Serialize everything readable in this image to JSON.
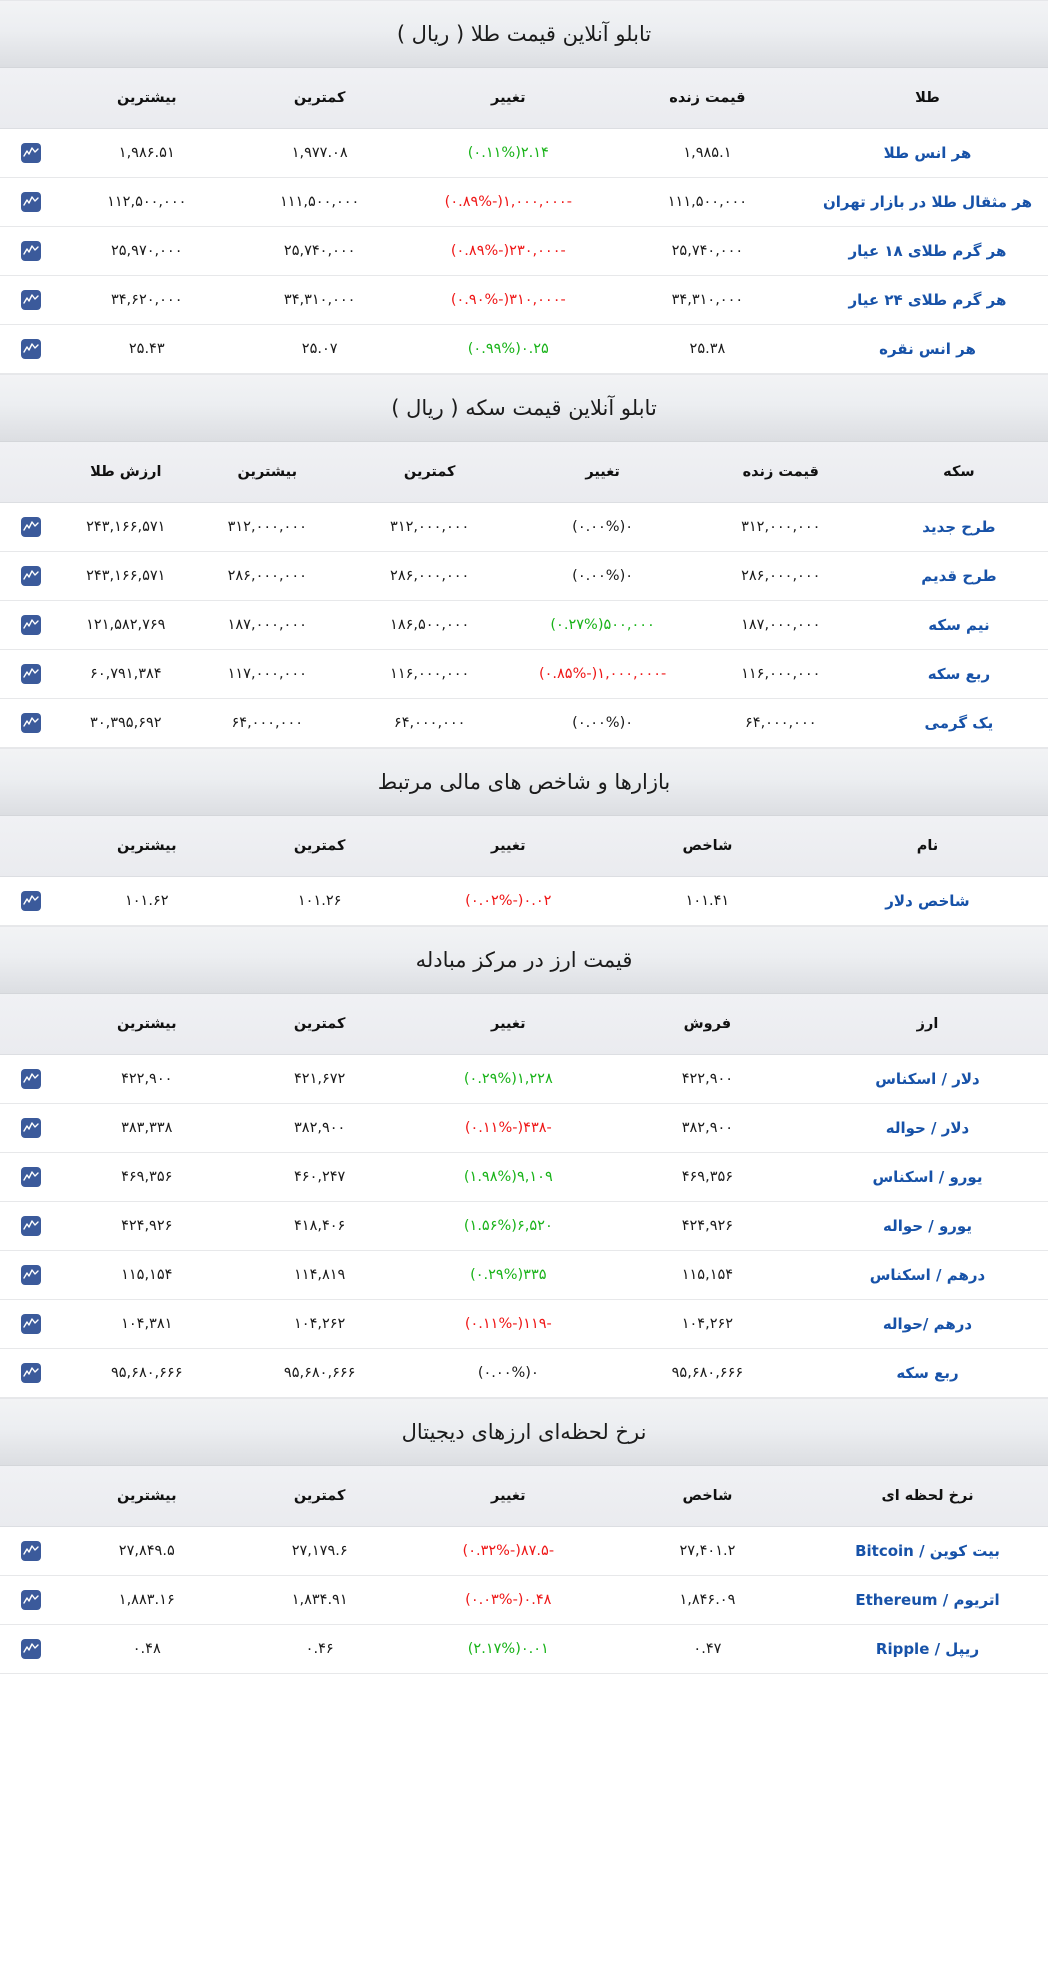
{
  "icons": {
    "chart": "chart-line-icon"
  },
  "colors": {
    "up": "#19b319",
    "down": "#ef1717",
    "flat": "#1a1a1a",
    "link": "#1752a8",
    "icon_bg": "#3b5a9b"
  },
  "sections": [
    {
      "id": "gold",
      "title": "تابلو آنلاین قیمت طلا ( ریال )",
      "columns": [
        "طلا",
        "قیمت زنده",
        "تغییر",
        "کمترین",
        "بیشترین"
      ],
      "rows": [
        {
          "name": "هر انس طلا",
          "live": "۱,۹۸۵.۱",
          "change": "۲.۱۴(۰.۱۱%)",
          "dir": "up",
          "low": "۱,۹۷۷.۰۸",
          "high": "۱,۹۸۶.۵۱"
        },
        {
          "name": "هر مثقال طلا در بازار تهران",
          "live": "۱۱۱,۵۰۰,۰۰۰",
          "change": "-۱,۰۰۰,۰۰۰(-۰.۸۹%)",
          "dir": "down",
          "low": "۱۱۱,۵۰۰,۰۰۰",
          "high": "۱۱۲,۵۰۰,۰۰۰"
        },
        {
          "name": "هر گرم طلای ۱۸ عیار",
          "live": "۲۵,۷۴۰,۰۰۰",
          "change": "-۲۳۰,۰۰۰(-۰.۸۹%)",
          "dir": "down",
          "low": "۲۵,۷۴۰,۰۰۰",
          "high": "۲۵,۹۷۰,۰۰۰"
        },
        {
          "name": "هر گرم طلای ۲۴ عیار",
          "live": "۳۴,۳۱۰,۰۰۰",
          "change": "-۳۱۰,۰۰۰(-۰.۹۰%)",
          "dir": "down",
          "low": "۳۴,۳۱۰,۰۰۰",
          "high": "۳۴,۶۲۰,۰۰۰"
        },
        {
          "name": "هر انس نقره",
          "live": "۲۵.۳۸",
          "change": "۰.۲۵(۰.۹۹%)",
          "dir": "up",
          "low": "۲۵.۰۷",
          "high": "۲۵.۴۳"
        }
      ]
    },
    {
      "id": "coin",
      "title": "تابلو آنلاین قیمت سکه ( ریال )",
      "columns": [
        "سکه",
        "قیمت زنده",
        "تغییر",
        "کمترین",
        "بیشترین",
        "ارزش طلا"
      ],
      "rows": [
        {
          "name": "طرح جدید",
          "live": "۳۱۲,۰۰۰,۰۰۰",
          "change": "۰(۰.۰۰%)",
          "dir": "flat",
          "low": "۳۱۲,۰۰۰,۰۰۰",
          "high": "۳۱۲,۰۰۰,۰۰۰",
          "gold": "۲۴۳,۱۶۶,۵۷۱"
        },
        {
          "name": "طرح قدیم",
          "live": "۲۸۶,۰۰۰,۰۰۰",
          "change": "۰(۰.۰۰%)",
          "dir": "flat",
          "low": "۲۸۶,۰۰۰,۰۰۰",
          "high": "۲۸۶,۰۰۰,۰۰۰",
          "gold": "۲۴۳,۱۶۶,۵۷۱"
        },
        {
          "name": "نیم سکه",
          "live": "۱۸۷,۰۰۰,۰۰۰",
          "change": "۵۰۰,۰۰۰(۰.۲۷%)",
          "dir": "up",
          "low": "۱۸۶,۵۰۰,۰۰۰",
          "high": "۱۸۷,۰۰۰,۰۰۰",
          "gold": "۱۲۱,۵۸۲,۷۶۹"
        },
        {
          "name": "ربع سکه",
          "live": "۱۱۶,۰۰۰,۰۰۰",
          "change": "-۱,۰۰۰,۰۰۰(-۰.۸۵%)",
          "dir": "down",
          "low": "۱۱۶,۰۰۰,۰۰۰",
          "high": "۱۱۷,۰۰۰,۰۰۰",
          "gold": "۶۰,۷۹۱,۳۸۴"
        },
        {
          "name": "یک گرمی",
          "live": "۶۴,۰۰۰,۰۰۰",
          "change": "۰(۰.۰۰%)",
          "dir": "flat",
          "low": "۶۴,۰۰۰,۰۰۰",
          "high": "۶۴,۰۰۰,۰۰۰",
          "gold": "۳۰,۳۹۵,۶۹۲"
        }
      ]
    },
    {
      "id": "markets",
      "title": "بازارها و شاخص های مالی مرتبط",
      "columns": [
        "نام",
        "شاخص",
        "تغییر",
        "کمترین",
        "بیشترین"
      ],
      "rows": [
        {
          "name": "شاخص دلار",
          "live": "۱۰۱.۴۱",
          "change": "۰.۰۲(-۰.۰۲%)",
          "dir": "down",
          "low": "۱۰۱.۲۶",
          "high": "۱۰۱.۶۲"
        }
      ]
    },
    {
      "id": "exchange",
      "title": "قیمت ارز در مرکز مبادله",
      "columns": [
        "ارز",
        "فروش",
        "تغییر",
        "کمترین",
        "بیشترین"
      ],
      "rows": [
        {
          "name": "دلار / اسکناس",
          "live": "۴۲۲,۹۰۰",
          "change": "۱,۲۲۸(۰.۲۹%)",
          "dir": "up",
          "low": "۴۲۱,۶۷۲",
          "high": "۴۲۲,۹۰۰"
        },
        {
          "name": "دلار / حواله",
          "live": "۳۸۲,۹۰۰",
          "change": "-۴۳۸(-۰.۱۱%)",
          "dir": "down",
          "low": "۳۸۲,۹۰۰",
          "high": "۳۸۳,۳۳۸"
        },
        {
          "name": "یورو / اسکناس",
          "live": "۴۶۹,۳۵۶",
          "change": "۹,۱۰۹(۱.۹۸%)",
          "dir": "up",
          "low": "۴۶۰,۲۴۷",
          "high": "۴۶۹,۳۵۶"
        },
        {
          "name": "یورو / حواله",
          "live": "۴۲۴,۹۲۶",
          "change": "۶,۵۲۰(۱.۵۶%)",
          "dir": "up",
          "low": "۴۱۸,۴۰۶",
          "high": "۴۲۴,۹۲۶"
        },
        {
          "name": "درهم / اسکناس",
          "live": "۱۱۵,۱۵۴",
          "change": "۳۳۵(۰.۲۹%)",
          "dir": "up",
          "low": "۱۱۴,۸۱۹",
          "high": "۱۱۵,۱۵۴"
        },
        {
          "name": "درهم /حواله",
          "live": "۱۰۴,۲۶۲",
          "change": "-۱۱۹(-۰.۱۱%)",
          "dir": "down",
          "low": "۱۰۴,۲۶۲",
          "high": "۱۰۴,۳۸۱"
        },
        {
          "name": "ربع سکه",
          "live": "۹۵,۶۸۰,۶۶۶",
          "change": "۰(۰.۰۰%)",
          "dir": "flat",
          "low": "۹۵,۶۸۰,۶۶۶",
          "high": "۹۵,۶۸۰,۶۶۶"
        }
      ]
    },
    {
      "id": "crypto",
      "title": "نرخ لحظه‌ای ارزهای دیجیتال",
      "columns": [
        "نرخ لحظه ای",
        "شاخص",
        "تغییر",
        "کمترین",
        "بیشترین"
      ],
      "rows": [
        {
          "name": "بیت کوین / Bitcoin",
          "live": "۲۷,۴۰۱.۲",
          "change": "-۸۷.۵(-۰.۳۲%)",
          "dir": "down",
          "low": "۲۷,۱۷۹.۶",
          "high": "۲۷,۸۴۹.۵"
        },
        {
          "name": "اتریوم / Ethereum",
          "live": "۱,۸۴۶.۰۹",
          "change": "۰.۴۸(-۰.۰۳%)",
          "dir": "down",
          "low": "۱,۸۳۴.۹۱",
          "high": "۱,۸۸۳.۱۶"
        },
        {
          "name": "ریپل / Ripple",
          "live": "۰.۴۷",
          "change": "۰.۰۱(۲.۱۷%)",
          "dir": "up",
          "low": "۰.۴۶",
          "high": "۰.۴۸"
        }
      ]
    }
  ]
}
